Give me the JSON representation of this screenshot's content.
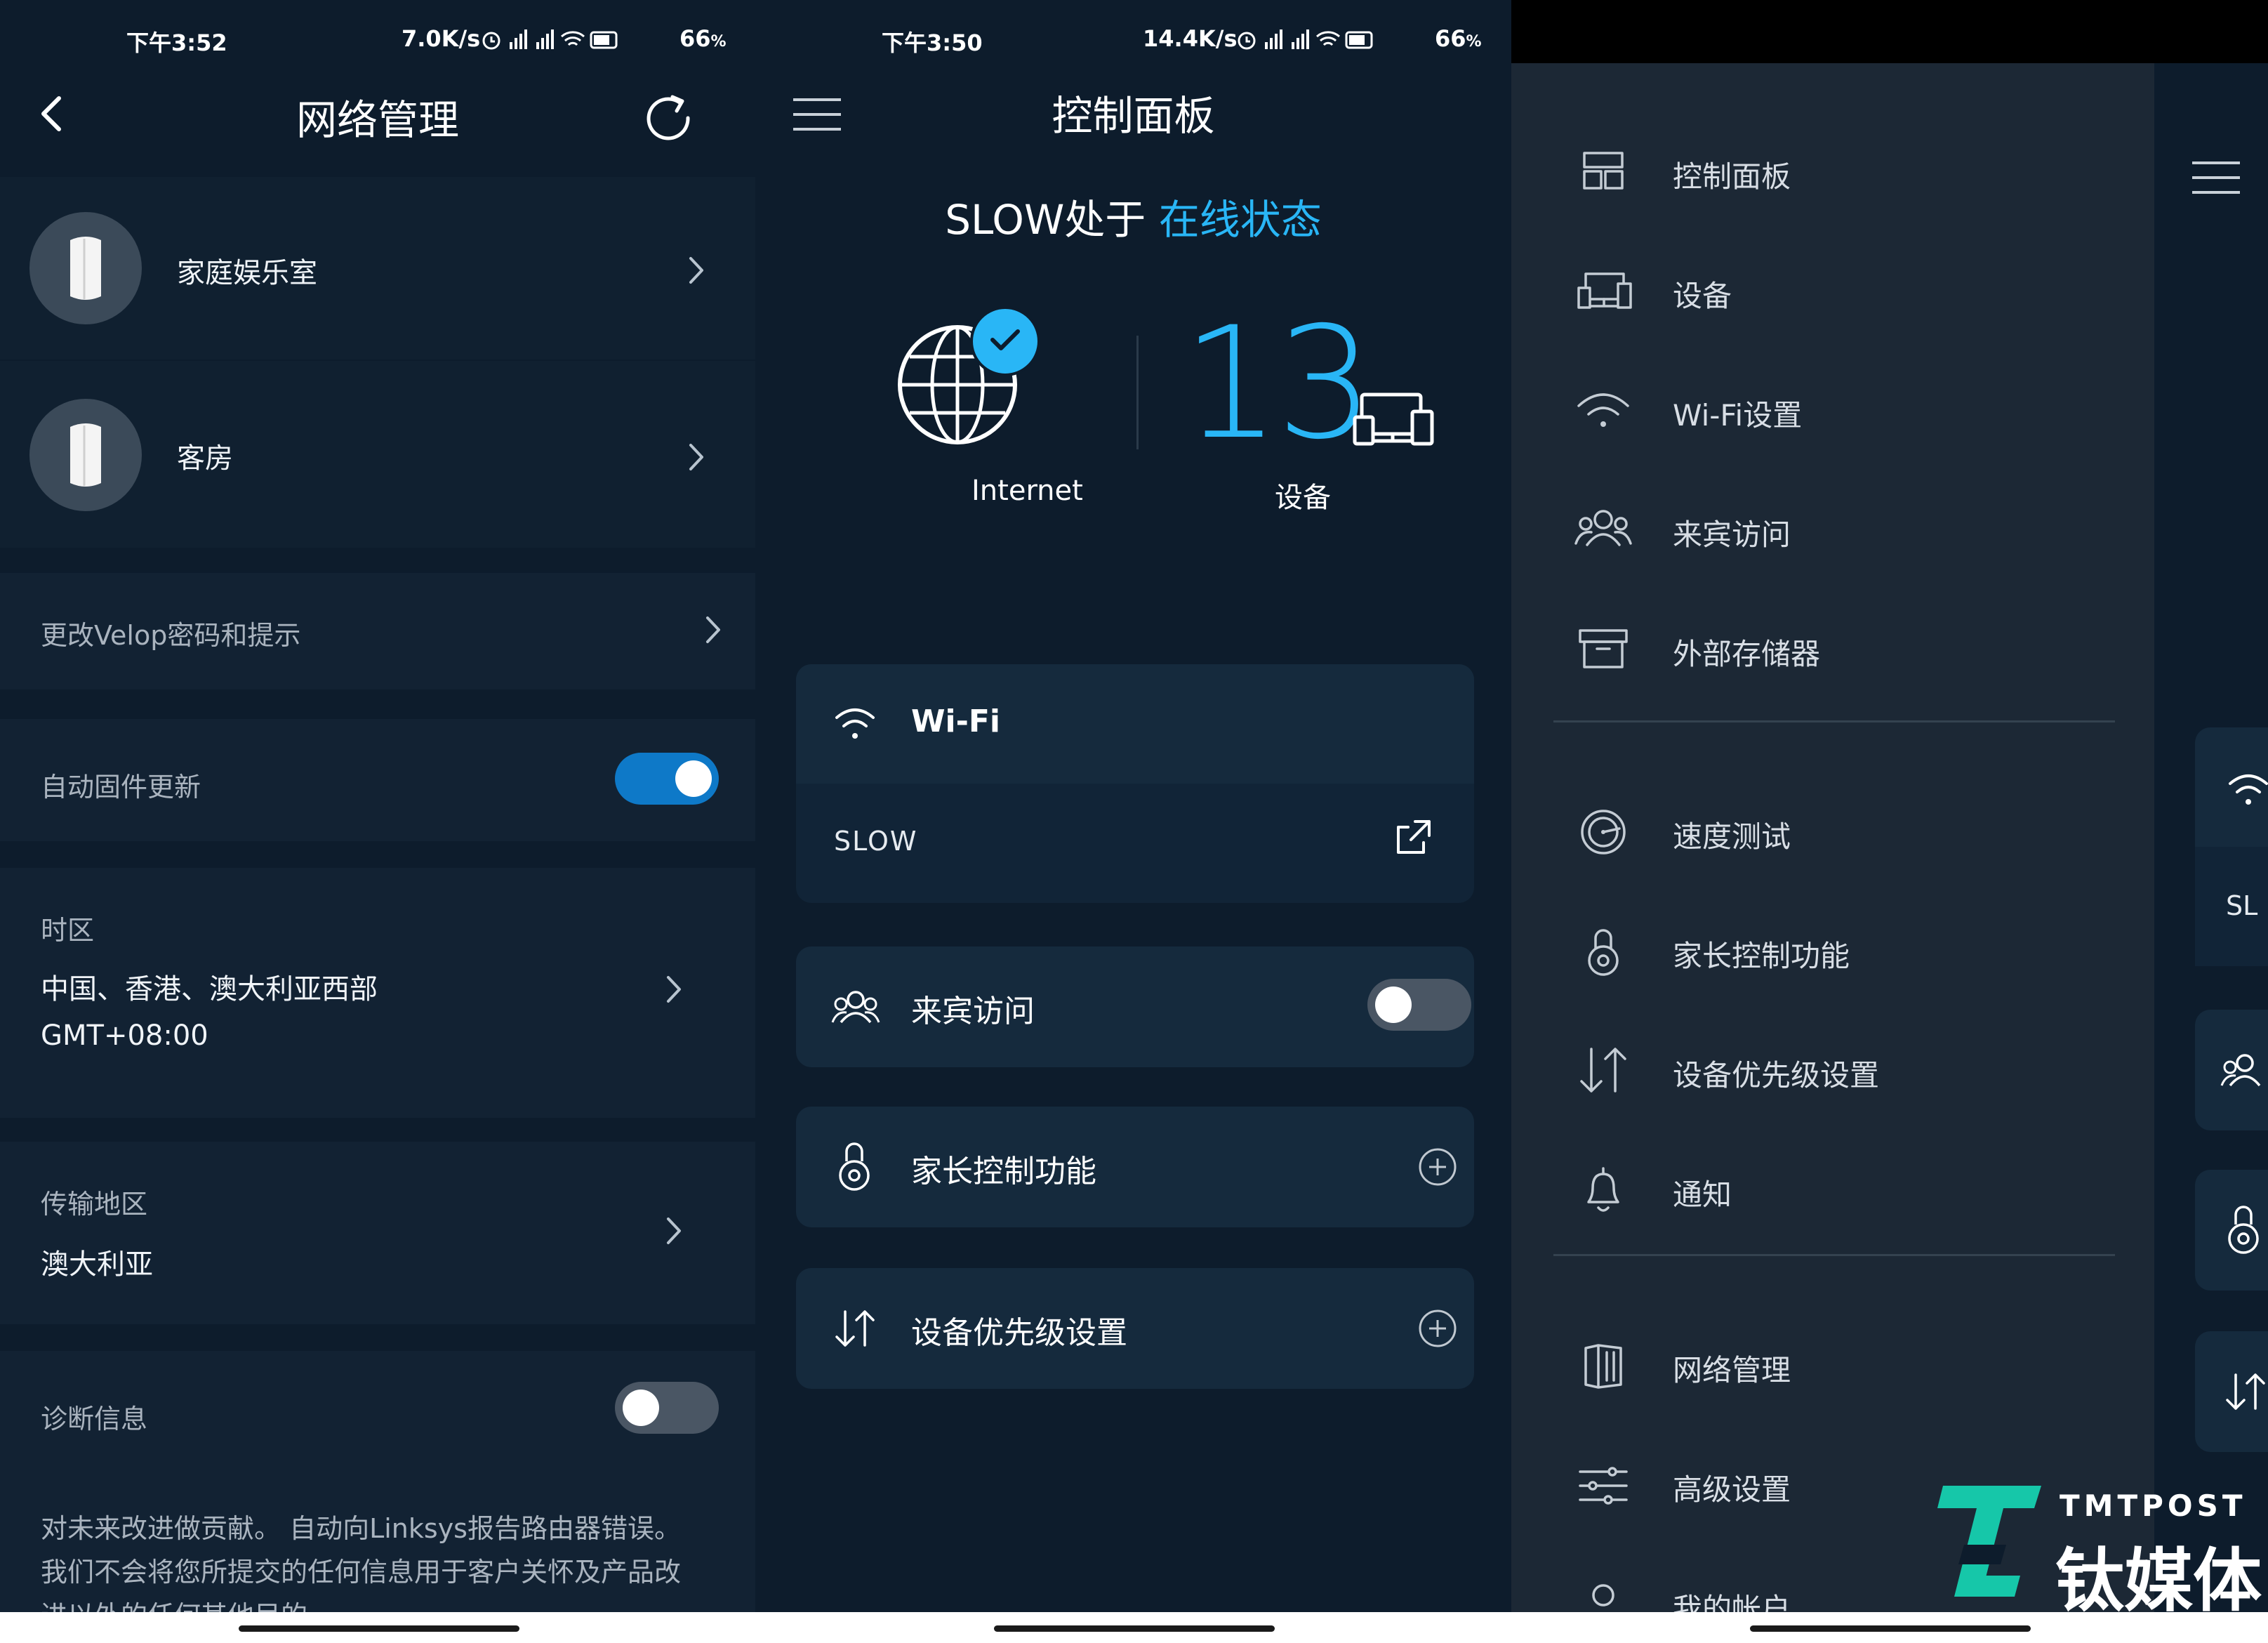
{
  "panel1": {
    "status": {
      "time": "下午3:52",
      "speed": "7.0K/s",
      "battery": "66"
    },
    "header": {
      "title": "网络管理"
    },
    "nodes": [
      {
        "name": "家庭娱乐室"
      },
      {
        "name": "客房"
      }
    ],
    "change_password": {
      "label": "更改Velop密码和提示"
    },
    "auto_update": {
      "label": "自动固件更新",
      "enabled": true
    },
    "timezone": {
      "label": "时区",
      "value": "中国、香港、澳大利亚西部",
      "offset": "GMT+08:00"
    },
    "region": {
      "label": "传输地区",
      "value": "澳大利亚"
    },
    "diagnostics": {
      "label": "诊断信息",
      "enabled": false,
      "desc_line1": "对未来改进做贡献。 自动向Linksys报告路由器错误。",
      "desc_line2": "我们不会将您所提交的任何信息用于客户关怀及产品改",
      "desc_line3": "进以外的任何其他目的"
    }
  },
  "panel2": {
    "status": {
      "time": "下午3:50",
      "speed": "14.4K/s",
      "battery": "66"
    },
    "header": {
      "title": "控制面板"
    },
    "network": {
      "name_prefix": "SLOW处于 ",
      "state": "在线状态"
    },
    "internet_label": "Internet",
    "device_count": "13",
    "devices_label": "设备",
    "wifi_card": {
      "title": "Wi-Fi",
      "ssid": "SLOW"
    },
    "guest_card": {
      "title": "来宾访问",
      "enabled": false
    },
    "parental_card": {
      "title": "家长控制功能"
    },
    "priority_card": {
      "title": "设备优先级设置"
    }
  },
  "panel3": {
    "menu_group1": [
      {
        "label": "控制面板",
        "icon": "dashboard-icon"
      },
      {
        "label": "设备",
        "icon": "devices-icon"
      },
      {
        "label": "Wi-Fi设置",
        "icon": "wifi-icon"
      },
      {
        "label": "来宾访问",
        "icon": "guest-icon"
      },
      {
        "label": "外部存储器",
        "icon": "storage-icon"
      }
    ],
    "menu_group2": [
      {
        "label": "速度测试",
        "icon": "speedtest-icon"
      },
      {
        "label": "家长控制功能",
        "icon": "lock-icon"
      },
      {
        "label": "设备优先级设置",
        "icon": "priority-icon"
      },
      {
        "label": "通知",
        "icon": "bell-icon"
      }
    ],
    "menu_group3": [
      {
        "label": "网络管理",
        "icon": "network-admin-icon"
      },
      {
        "label": "高级设置",
        "icon": "sliders-icon"
      },
      {
        "label": "我的帐户",
        "icon": "account-icon"
      }
    ],
    "peek_ssid": "SL"
  },
  "watermark": {
    "brand": "TMTPOST",
    "brand_cn": "钛媒体"
  },
  "colors": {
    "accent": "#29b6f6",
    "toggle_on": "#0e79c8",
    "background": "#0d1c2c",
    "card": "#122233",
    "watermark": "#16c7a9"
  }
}
